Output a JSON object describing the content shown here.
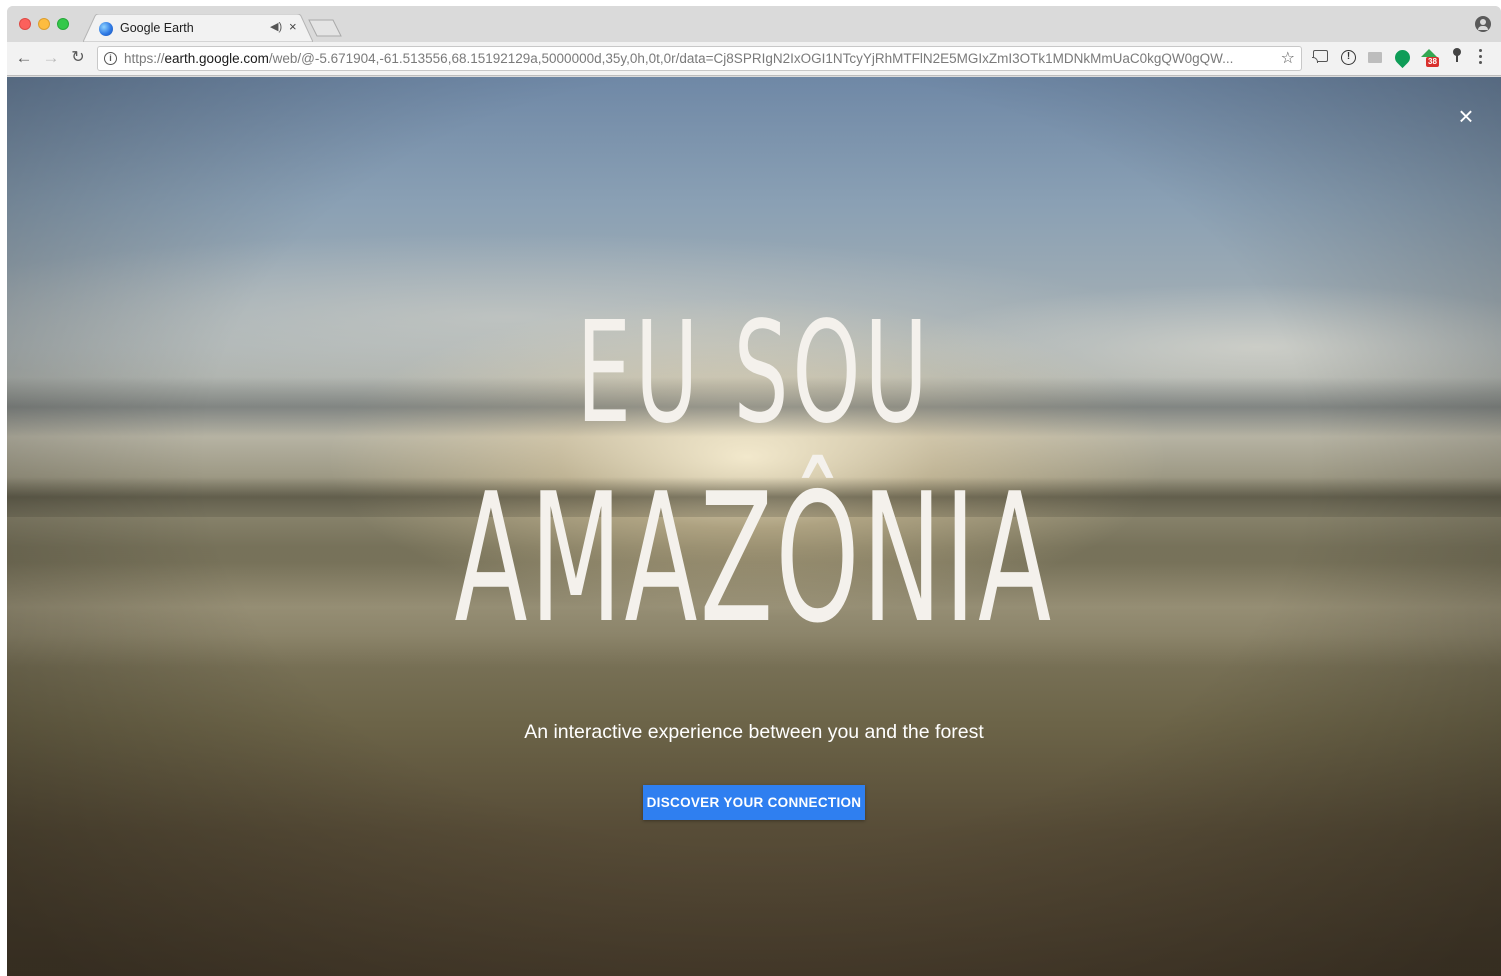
{
  "browser": {
    "tab": {
      "title": "Google Earth",
      "audio_icon": "speaker-icon",
      "close": "×"
    },
    "url": {
      "prefix": "https://",
      "host": "earth.google.com",
      "path": "/web/@-5.671904,-61.513556,68.15192129a,5000000d,35y,0h,0t,0r/data=Cj8SPRIgN2IxOGI1NTcyYjRhMTFlN2E5MGIxZmI3OTk1MDNkMmUaC0kgQW0gQW..."
    },
    "extensions": {
      "house_badge": "38"
    }
  },
  "hero": {
    "title_line1": "EU SOU",
    "title_line2": "AMAZÔNIA",
    "subtitle": "An interactive experience between you and the forest",
    "cta_label": "DISCOVER YOUR CONNECTION",
    "close_label": "×"
  },
  "colors": {
    "cta_background": "#2f7ff0",
    "text": "#ffffff"
  }
}
